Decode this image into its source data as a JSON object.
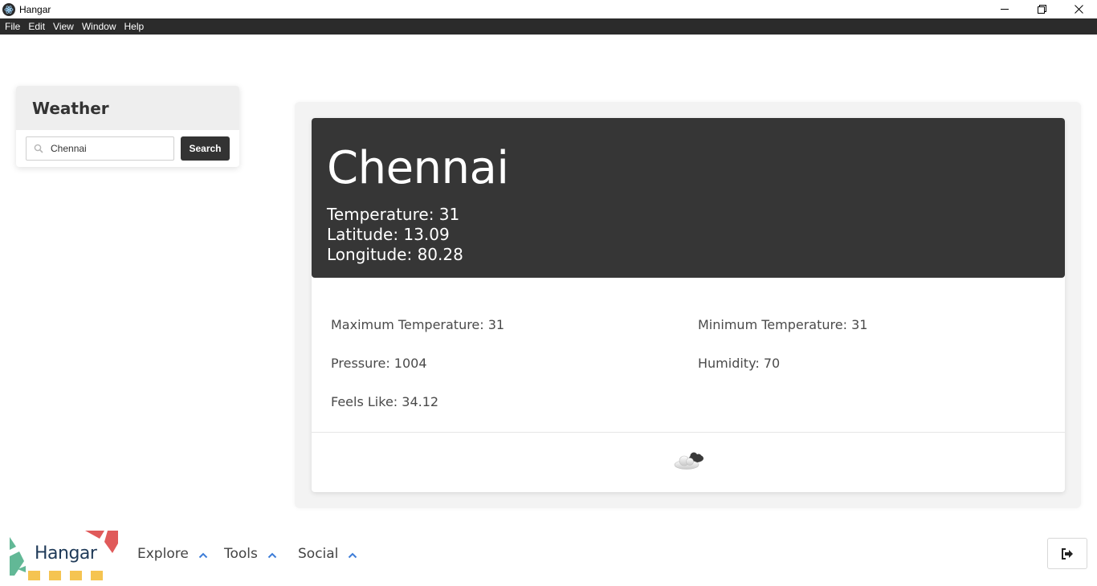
{
  "window": {
    "title": "Hangar",
    "controls": [
      "minimize",
      "restore",
      "close"
    ]
  },
  "menu": {
    "items": [
      "File",
      "Edit",
      "View",
      "Window",
      "Help"
    ]
  },
  "search_panel": {
    "title": "Weather",
    "input_value": "Chennai",
    "button_label": "Search"
  },
  "result": {
    "city": "Chennai",
    "temperature": "Temperature: 31",
    "latitude": "Latitude: 13.09",
    "longitude": "Longitude: 80.28",
    "max_temp": "Maximum Temperature: 31",
    "min_temp": "Minimum Temperature: 31",
    "pressure": "Pressure: 1004",
    "humidity": "Humidity: 70",
    "feels_like": "Feels Like: 34.12",
    "icon": "cloud-icon"
  },
  "footer": {
    "logo_text": "Hangar",
    "nav": [
      {
        "label": "Explore",
        "icon": "chevron-up-icon"
      },
      {
        "label": "Tools",
        "icon": "chevron-up-icon"
      },
      {
        "label": "Social",
        "icon": "chevron-up-icon"
      }
    ],
    "logout_icon": "sign-out-icon"
  },
  "colors": {
    "menubar": "#2b2b2b",
    "header_dark": "#363636",
    "accent_blue": "#3d7dd8",
    "logo_red": "#e05a5a",
    "logo_green": "#62b896",
    "logo_yellow": "#f5c451"
  }
}
